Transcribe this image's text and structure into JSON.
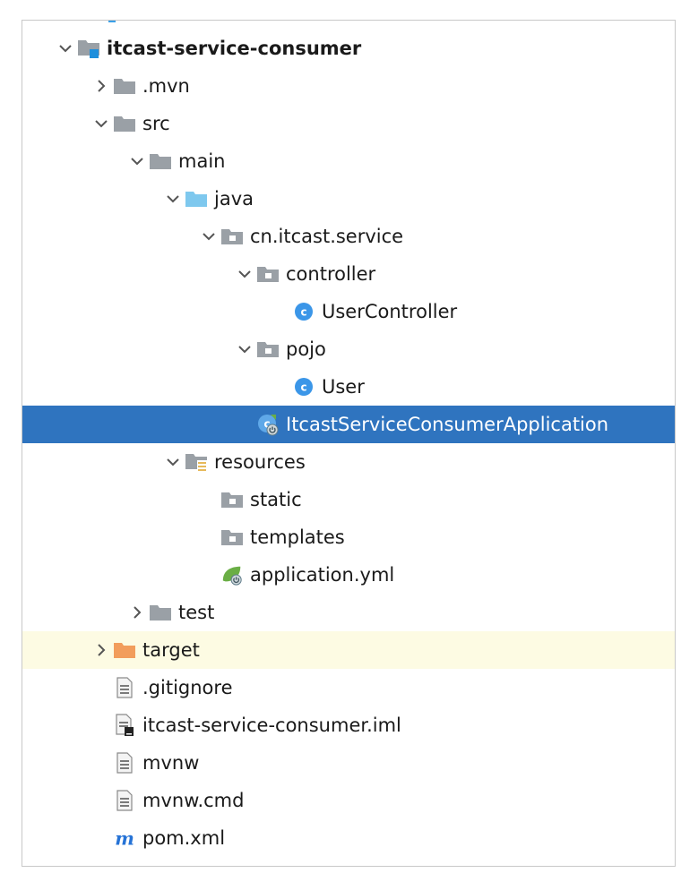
{
  "colors": {
    "selection": "#2f74bf",
    "excluded_row": "#fdfbe3",
    "folder_gray": "#9aa0a6",
    "source_folder": "#7ec8ee",
    "excluded_folder": "#f29d5c",
    "class_icon": "#3b96e8",
    "spring_green": "#6aae45",
    "maven_blue": "#2673d6"
  },
  "tree": {
    "rows": [
      {
        "label": "itcast-service-consumer",
        "depth": 1,
        "chevron": "down",
        "icon": "module-folder-icon",
        "bold": true
      },
      {
        "label": ".mvn",
        "depth": 2,
        "chevron": "right",
        "icon": "folder-icon"
      },
      {
        "label": "src",
        "depth": 2,
        "chevron": "down",
        "icon": "folder-icon"
      },
      {
        "label": "main",
        "depth": 3,
        "chevron": "down",
        "icon": "folder-icon"
      },
      {
        "label": "java",
        "depth": 4,
        "chevron": "down",
        "icon": "source-folder-icon"
      },
      {
        "label": "cn.itcast.service",
        "depth": 5,
        "chevron": "down",
        "icon": "package-icon"
      },
      {
        "label": "controller",
        "depth": 6,
        "chevron": "down",
        "icon": "package-icon"
      },
      {
        "label": "UserController",
        "depth": 7,
        "chevron": "none",
        "icon": "class-icon"
      },
      {
        "label": "pojo",
        "depth": 6,
        "chevron": "down",
        "icon": "package-icon"
      },
      {
        "label": "User",
        "depth": 7,
        "chevron": "none",
        "icon": "class-icon"
      },
      {
        "label": "ItcastServiceConsumerApplication",
        "depth": 6,
        "chevron": "none",
        "icon": "spring-boot-class-icon",
        "selected": true
      },
      {
        "label": "resources",
        "depth": 4,
        "chevron": "down",
        "icon": "resources-folder-icon"
      },
      {
        "label": "static",
        "depth": 5,
        "chevron": "none",
        "icon": "package-icon"
      },
      {
        "label": "templates",
        "depth": 5,
        "chevron": "none",
        "icon": "package-icon"
      },
      {
        "label": "application.yml",
        "depth": 5,
        "chevron": "none",
        "icon": "spring-config-icon"
      },
      {
        "label": "test",
        "depth": 3,
        "chevron": "right",
        "icon": "folder-icon"
      },
      {
        "label": "target",
        "depth": 2,
        "chevron": "right",
        "icon": "excluded-folder-icon",
        "highlight": true
      },
      {
        "label": ".gitignore",
        "depth": 2,
        "chevron": "none",
        "icon": "text-file-icon"
      },
      {
        "label": "itcast-service-consumer.iml",
        "depth": 2,
        "chevron": "none",
        "icon": "iml-file-icon"
      },
      {
        "label": "mvnw",
        "depth": 2,
        "chevron": "none",
        "icon": "text-file-icon"
      },
      {
        "label": "mvnw.cmd",
        "depth": 2,
        "chevron": "none",
        "icon": "text-file-icon"
      },
      {
        "label": "pom.xml",
        "depth": 2,
        "chevron": "none",
        "icon": "maven-icon"
      }
    ]
  }
}
